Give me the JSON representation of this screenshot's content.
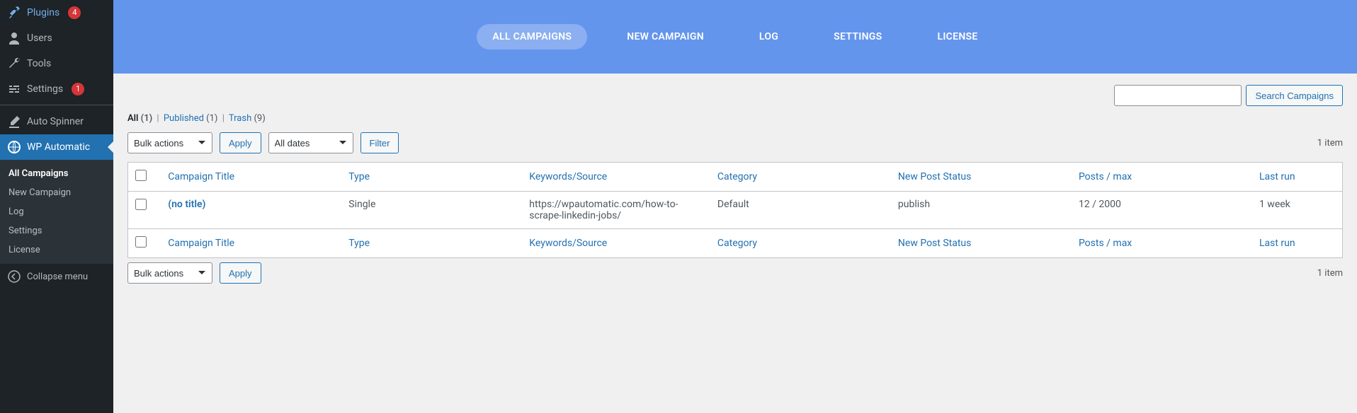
{
  "sidebar": {
    "items": [
      {
        "icon": "plug",
        "label": "Plugins",
        "badge": "4"
      },
      {
        "icon": "user",
        "label": "Users"
      },
      {
        "icon": "wrench",
        "label": "Tools"
      },
      {
        "icon": "slider",
        "label": "Settings",
        "badge": "1"
      }
    ],
    "extra": [
      {
        "icon": "edit",
        "label": "Auto Spinner"
      }
    ],
    "active": {
      "icon": "globe",
      "label": "WP Automatic"
    },
    "submenu": [
      {
        "label": "All Campaigns",
        "current": true
      },
      {
        "label": "New Campaign"
      },
      {
        "label": "Log"
      },
      {
        "label": "Settings"
      },
      {
        "label": "License"
      }
    ],
    "collapse": "Collapse menu"
  },
  "topnav": {
    "items": [
      {
        "label": "ALL CAMPAIGNS",
        "active": true
      },
      {
        "label": "NEW CAMPAIGN"
      },
      {
        "label": "LOG"
      },
      {
        "label": "SETTINGS"
      },
      {
        "label": "LICENSE"
      }
    ]
  },
  "views": {
    "all_label": "All",
    "all_count": "(1)",
    "published_label": "Published",
    "published_count": "(1)",
    "trash_label": "Trash",
    "trash_count": "(9)"
  },
  "search": {
    "button": "Search Campaigns",
    "placeholder": ""
  },
  "bulk": {
    "option": "Bulk actions",
    "apply": "Apply"
  },
  "dates": {
    "option": "All dates",
    "filter": "Filter"
  },
  "count_label": "1 item",
  "table": {
    "headers": {
      "title": "Campaign Title",
      "type": "Type",
      "source": "Keywords/Source",
      "category": "Category",
      "status": "New Post Status",
      "posts": "Posts / max",
      "last": "Last run"
    },
    "rows": [
      {
        "title": "(no title)",
        "type": "Single",
        "source": "https://wpautomatic.com/how-to-scrape-linkedin-jobs/",
        "category": "Default",
        "status": "publish",
        "posts": "12 / 2000",
        "last": "1 week"
      }
    ]
  }
}
